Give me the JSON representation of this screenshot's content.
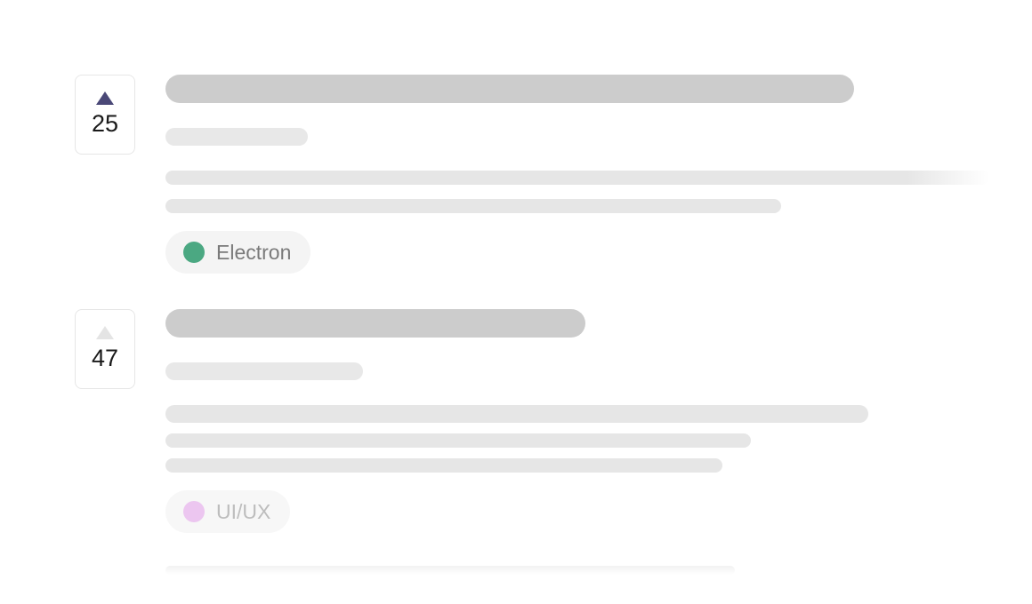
{
  "posts": [
    {
      "votes": "25",
      "upvoted": true,
      "tag": {
        "label": "Electron",
        "color": "#4ba882"
      }
    },
    {
      "votes": "47",
      "upvoted": false,
      "tag": {
        "label": "UI/UX",
        "color": "#ecc6f0"
      }
    }
  ],
  "colors": {
    "upvote_active": "#4a4877",
    "upvote_inactive": "#e4e4e4",
    "skeleton_title": "#cccccc",
    "skeleton_text": "#e6e6e6"
  }
}
